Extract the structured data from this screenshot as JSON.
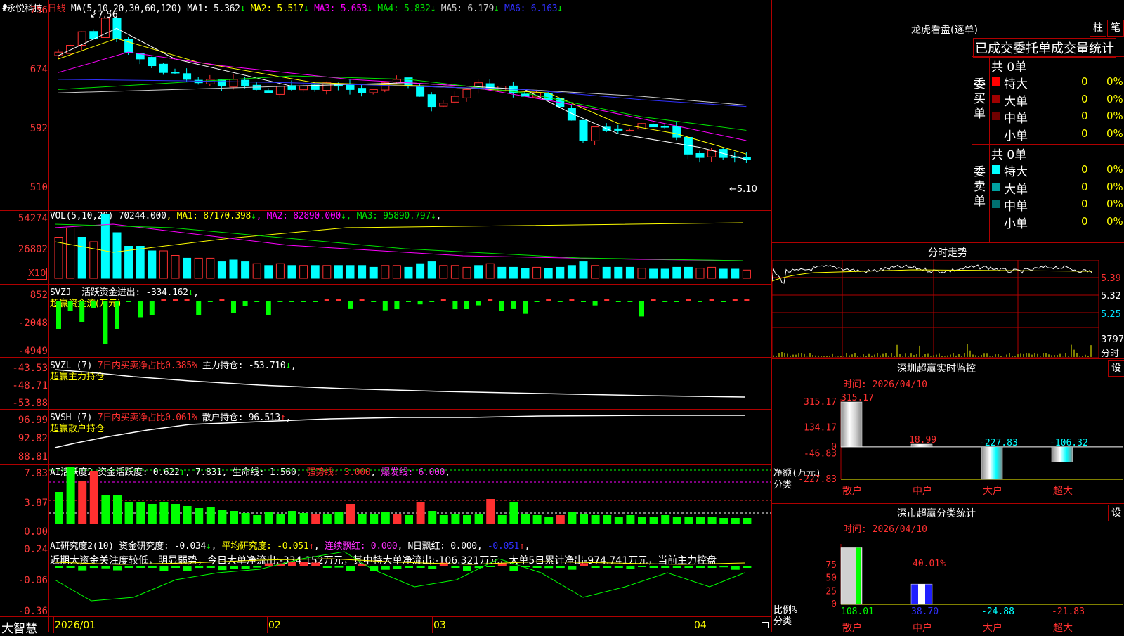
{
  "kline": {
    "stock": "永悦科技",
    "period": "日线",
    "ma_label": "MA(5,10,20,30,60,120)",
    "mas": [
      {
        "name": "MA1",
        "val": "5.362",
        "arrow": "↓",
        "color": "#ffffff"
      },
      {
        "name": "MA2",
        "val": "5.517",
        "arrow": "↓",
        "color": "#ffff00"
      },
      {
        "name": "MA3",
        "val": "5.653",
        "arrow": "↓",
        "color": "#ff00ff"
      },
      {
        "name": "MA4",
        "val": "5.832",
        "arrow": "↓",
        "color": "#00e000"
      },
      {
        "name": "MA5",
        "val": "6.179",
        "arrow": "↓",
        "color": "#cccccc"
      },
      {
        "name": "MA6",
        "val": "6.163",
        "arrow": "↓",
        "color": "#3030ff"
      }
    ],
    "axis": [
      "756",
      "674",
      "592",
      "510"
    ],
    "high_mark": "7.56",
    "low_mark": "5.10"
  },
  "vol": {
    "label": "VOL(5,10,20)",
    "value": "70244.000",
    "mas": [
      {
        "name": "MA1",
        "val": "87170.398",
        "arrow": "↓",
        "color": "#ffff00"
      },
      {
        "name": "MA2",
        "val": "82890.000",
        "arrow": "↓",
        "color": "#ff00ff"
      },
      {
        "name": "MA3",
        "val": "95890.797",
        "arrow": "↓",
        "color": "#00e000"
      }
    ],
    "axis": [
      "54274",
      "26802"
    ],
    "unit": "X10"
  },
  "svzj": {
    "label": "SVZJ",
    "title": "活跃资金进出",
    "val": "-334.162",
    "arrow": "↓",
    "sub": "超赢资金流(万元)",
    "axis": [
      "852",
      "-2048",
      "-4949"
    ]
  },
  "svzl": {
    "label": "SVZL (7)",
    "ratio": "7日内买卖净占比0.385%",
    "title": "主力持仓",
    "val": "-53.710",
    "arrow": "↓",
    "sub": "超赢主力持仓",
    "axis": [
      "-43.53",
      "-48.71",
      "-53.88"
    ]
  },
  "svsh": {
    "label": "SVSH (7)",
    "ratio": "7日内买卖净占比0.061%",
    "title": "散户持仓",
    "val": "96.513",
    "arrow": "↑",
    "sub": "超赢散户持仓",
    "axis": [
      "96.99",
      "92.82",
      "88.81"
    ]
  },
  "ai1": {
    "label": "AI活跃度2",
    "items": [
      {
        "text": "资金活跃度: 0.622",
        "arrow": "↓",
        "color": "#ffffff"
      },
      {
        "text": "7.831",
        "arrow": "",
        "color": "#ffffff"
      },
      {
        "text": "生命线: 1.560",
        "arrow": "",
        "color": "#ffffff"
      },
      {
        "text": "强势线: 3.000",
        "arrow": "",
        "color": "#ff3030"
      },
      {
        "text": "爆发线: 6.000",
        "arrow": "",
        "color": "#ff30ff"
      }
    ],
    "axis": [
      "7.83",
      "3.87",
      "0.00"
    ]
  },
  "ai2": {
    "label": "AI研究度2(10)",
    "items": [
      {
        "text": "资金研究度: -0.034",
        "arrow": "↓",
        "color": "#ffffff"
      },
      {
        "text": "平均研究度: -0.051",
        "arrow": "↑",
        "color": "#ffff00"
      },
      {
        "text": "连续飘红: 0.000",
        "arrow": "",
        "color": "#ff30ff"
      },
      {
        "text": "N日飘红: 0.000",
        "arrow": "",
        "color": "#ffffff"
      },
      {
        "text": "-0.051",
        "arrow": "↑",
        "color": "#3030ff"
      }
    ],
    "note": "近期大资金关注度较低，明显弱势，今日大单净流出:-334.152万元，其中特大单净流出:-106.321万元，大单5日累计净出-974.741万元，当前主力控盘",
    "axis": [
      "0.24",
      "-0.06",
      "-0.36"
    ]
  },
  "dates": [
    "2026/01",
    "02",
    "03",
    "04"
  ],
  "brand": "大智慧",
  "lhb": {
    "title": "龙虎看盘(逐单)",
    "tab1": "柱",
    "tab2": "笔",
    "cols": "已成交委托单成交量统计",
    "buy_label": "委买单",
    "sell_label": "委卖单",
    "buy_total": "共 0单",
    "sell_total": "共 0单",
    "buy_rows": [
      {
        "name": "特大",
        "n": "0",
        "p": "0%",
        "color": "#ff0000"
      },
      {
        "name": "大单",
        "n": "0",
        "p": "0%",
        "color": "#a00000"
      },
      {
        "name": "中单",
        "n": "0",
        "p": "0%",
        "color": "#700000"
      },
      {
        "name": "小单",
        "n": "0",
        "p": "0%",
        "color": "#000000"
      }
    ],
    "sell_rows": [
      {
        "name": "特大",
        "n": "0",
        "p": "0%",
        "color": "#00ffff"
      },
      {
        "name": "大单",
        "n": "0",
        "p": "0%",
        "color": "#00a0a0"
      },
      {
        "name": "中单",
        "n": "0",
        "p": "0%",
        "color": "#007070"
      },
      {
        "name": "小单",
        "n": "0",
        "p": "0%",
        "color": "#000000"
      }
    ]
  },
  "intraday": {
    "title": "分时走势",
    "axis": [
      "5.39",
      "5.32",
      "5.25"
    ],
    "vol_val": "3797",
    "vol_label": "分时"
  },
  "szmon": {
    "title": "深圳超赢实时监控",
    "set": "设",
    "time": "时间: 2026/04/10",
    "ylabel": "净额(万元)",
    "xlabel": "分类",
    "axis": [
      "315.17",
      "134.17",
      "0",
      "-46.83",
      "-227.83"
    ],
    "cats": [
      "散户",
      "中户",
      "大户",
      "超大"
    ],
    "values": [
      315.17,
      18.99,
      -227.83,
      -106.32
    ],
    "labels": [
      "315.17",
      "18.99",
      "-227.83",
      "-106.32"
    ]
  },
  "szstat": {
    "title": "深市超赢分类统计",
    "set": "设",
    "time": "时间: 2026/04/10",
    "ylabel": "比例%",
    "xlabel": "分类",
    "axis": [
      "75",
      "50",
      "25",
      "0"
    ],
    "cats": [
      "散户",
      "中户",
      "大户",
      "超大"
    ],
    "values": [
      108.01,
      38.7,
      -24.88,
      -21.83
    ],
    "labels": [
      "108.01",
      "38.70",
      "-24.88",
      "-21.83"
    ],
    "pct": "40.01%"
  }
}
